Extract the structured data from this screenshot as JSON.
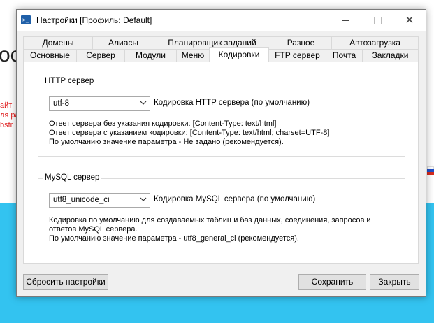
{
  "background": {
    "heading_fragment": "oc",
    "side_lines": [
      "айт",
      "ля ра",
      "bstr"
    ]
  },
  "window": {
    "title": "Настройки [Профиль: Default]"
  },
  "tabs": {
    "row1": [
      "Домены",
      "Алиасы",
      "Планировщик заданий",
      "Разное",
      "Автозагрузка"
    ],
    "row2": [
      "Основные",
      "Сервер",
      "Модули",
      "Меню",
      "Кодировки",
      "FTP сервер",
      "Почта",
      "Закладки"
    ],
    "active": "Кодировки"
  },
  "http": {
    "group_title": "HTTP сервер",
    "select_value": "utf-8",
    "select_label": "Кодировка HTTP сервера (по умолчанию)",
    "desc": [
      "Ответ сервера без указания кодировки: [Content-Type: text/html]",
      "Ответ сервера с указанием кодировки:   [Content-Type: text/html; charset=UTF-8]",
      "По умолчанию значение параметра - Не задано (рекомендуется)."
    ]
  },
  "mysql": {
    "group_title": "MySQL сервер",
    "select_value": "utf8_unicode_ci",
    "select_label": "Кодировка MySQL сервера (по умолчанию)",
    "desc": [
      "Кодировка по умолчанию для создаваемых таблиц и баз данных, соединения, запросов и",
      "ответов MySQL сервера.",
      "По умолчанию значение параметра - utf8_general_ci (рекомендуется)."
    ]
  },
  "buttons": {
    "reset": "Сбросить настройки",
    "save": "Сохранить",
    "close": "Закрыть"
  },
  "colors": {
    "background_blue": "#33c3f0",
    "accent_red": "#e02020"
  }
}
